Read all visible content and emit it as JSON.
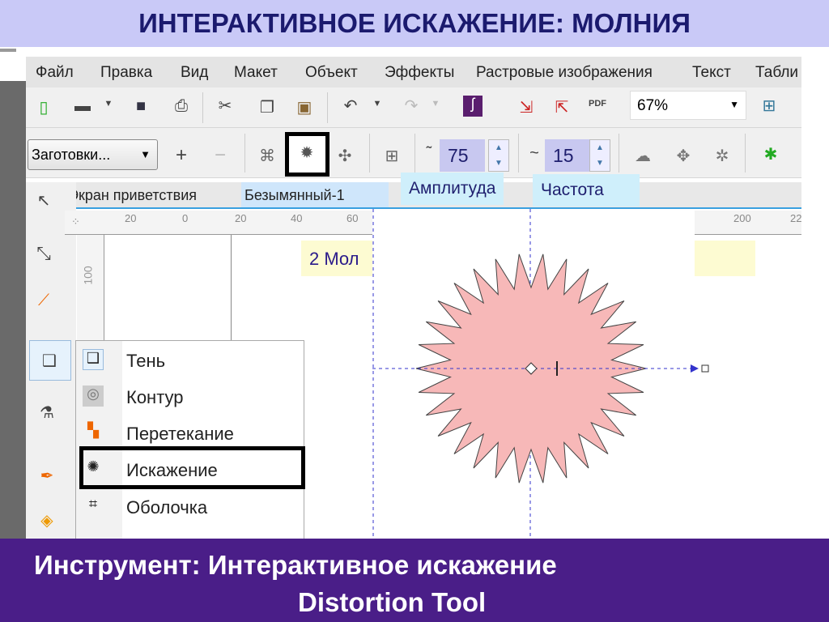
{
  "slide_title": "ИНТЕРАКТИВНОЕ ИСКАЖЕНИЕ: МОЛНИЯ",
  "menu": [
    "Файл",
    "Правка",
    "Вид",
    "Макет",
    "Объект",
    "Эффекты",
    "Растровые изображения",
    "Текст",
    "Табли"
  ],
  "zoom_level": "67%",
  "presets_label": "Заготовки...",
  "amplitude_value": "75",
  "frequency_value": "15",
  "amplitude_label": "Амплитуда",
  "frequency_label": "Частота",
  "tabs": [
    "Экран приветствия",
    "Безымянный-1"
  ],
  "ruler_ticks": [
    "20",
    "0",
    "20",
    "40",
    "60",
    "200",
    "22"
  ],
  "vruler_tick": "100",
  "canvas_note": "2 Мол",
  "popup_items": [
    "Тень",
    "Контур",
    "Перетекание",
    "Искажение",
    "Оболочка"
  ],
  "bottom_line1": "Инструмент: Интерактивное искажение",
  "bottom_line2": "Distortion Tool",
  "colors": {
    "title_bg": "#c9c9f7",
    "bottom_bg": "#4a1e88",
    "star_fill": "#f7b8b8"
  }
}
